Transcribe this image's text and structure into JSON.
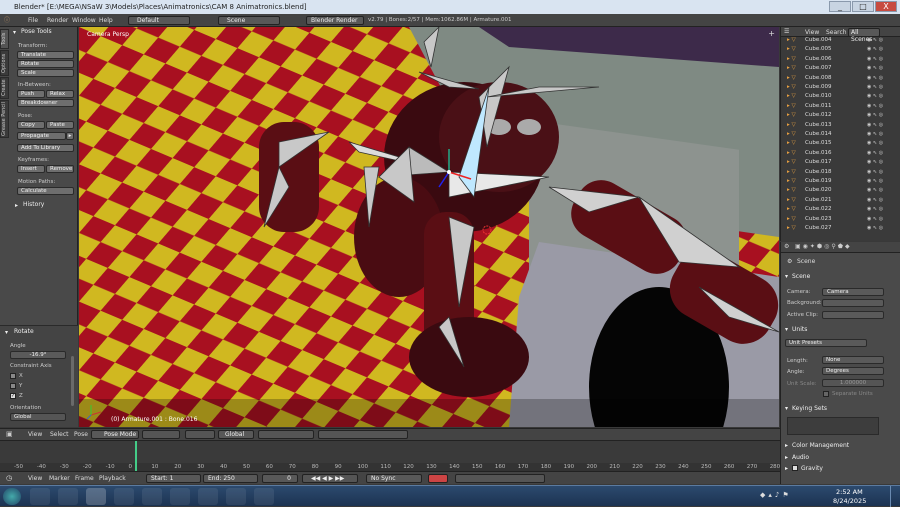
{
  "window": {
    "title": "Blender* [E:\\MEGA\\NSaW 3\\Models\\Places\\Animatronics\\CAM 8 Animatronics.blend]",
    "minimize": "_",
    "maximize": "□",
    "close": "X"
  },
  "menubar": {
    "items": [
      "File",
      "Render",
      "Window",
      "Help"
    ],
    "screen": "Default",
    "scene": "Scene",
    "engine": "Blender Render",
    "stats": "v2.79 | Bones:2/57 | Mem:1062.86M | Armature.001"
  },
  "toolshelf": {
    "tabs": [
      "Tools",
      "Options",
      "Create",
      "Grease Pencil"
    ],
    "panel_title": "Pose Tools",
    "transform_label": "Transform:",
    "translate": "Translate",
    "rotate": "Rotate",
    "scale": "Scale",
    "inbetween_label": "In-Between:",
    "push": "Push",
    "relax": "Relax",
    "breakdowner": "Breakdowner",
    "pose_label": "Pose:",
    "copy": "Copy",
    "paste": "Paste",
    "propagate": "Propagate",
    "add_to_library": "Add To Library",
    "keyframes_label": "Keyframes:",
    "insert": "Insert",
    "remove": "Remove",
    "motion_paths_label": "Motion Paths:",
    "calculate": "Calculate",
    "history": "History"
  },
  "operator_panel": {
    "title": "Rotate",
    "angle_label": "Angle",
    "angle_value": "-16.9°",
    "constraint_label": "Constraint Axis",
    "axes": [
      "X",
      "Y",
      "Z"
    ],
    "orientation_label": "Orientation",
    "orientation_value": "Global"
  },
  "viewport": {
    "label": "Camera Persp",
    "status": "(0) Armature.001 : Bone.016"
  },
  "viewport_header": {
    "view": "View",
    "select": "Select",
    "pose": "Pose",
    "mode": "Pose Mode",
    "orientation": "Global"
  },
  "timeline": {
    "ticks": [
      "-50",
      "-40",
      "-30",
      "-20",
      "-10",
      "0",
      "10",
      "20",
      "30",
      "40",
      "50",
      "60",
      "70",
      "80",
      "90",
      "100",
      "110",
      "120",
      "130",
      "140",
      "150",
      "160",
      "170",
      "180",
      "190",
      "200",
      "210",
      "220",
      "230",
      "240",
      "250",
      "260",
      "270",
      "280"
    ],
    "menu": [
      "View",
      "Marker",
      "Frame",
      "Playback"
    ],
    "start_label": "Start:",
    "start_value": "1",
    "end_label": "End:",
    "end_value": "250",
    "current_frame": "0",
    "sync": "No Sync"
  },
  "outliner": {
    "header": [
      "View",
      "Search",
      "All Scenes"
    ],
    "items": [
      "Cube.004",
      "Cube.005",
      "Cube.006",
      "Cube.007",
      "Cube.008",
      "Cube.009",
      "Cube.010",
      "Cube.011",
      "Cube.012",
      "Cube.013",
      "Cube.014",
      "Cube.015",
      "Cube.016",
      "Cube.017",
      "Cube.018",
      "Cube.019",
      "Cube.020",
      "Cube.021",
      "Cube.022",
      "Cube.023",
      "Cube.027"
    ]
  },
  "properties": {
    "breadcrumb": "Scene",
    "scene_panel": "Scene",
    "camera_label": "Camera:",
    "camera_value": "Camera",
    "background_label": "Background:",
    "active_clip_label": "Active Clip:",
    "units_panel": "Units",
    "unit_presets": "Unit Presets",
    "length_label": "Length:",
    "length_value": "None",
    "angle_label": "Angle:",
    "angle_value": "Degrees",
    "unit_scale_label": "Unit Scale:",
    "unit_scale_value": "1.000000",
    "separate_units": "Separate Units",
    "keying_sets": "Keying Sets",
    "color_management": "Color Management",
    "audio": "Audio",
    "gravity": "Gravity"
  },
  "taskbar": {
    "time": "2:52 AM",
    "date": "8/24/2025"
  },
  "colors": {
    "accent": "#5680c2",
    "checker_red": "#b01020",
    "checker_yellow": "#d8c020"
  }
}
